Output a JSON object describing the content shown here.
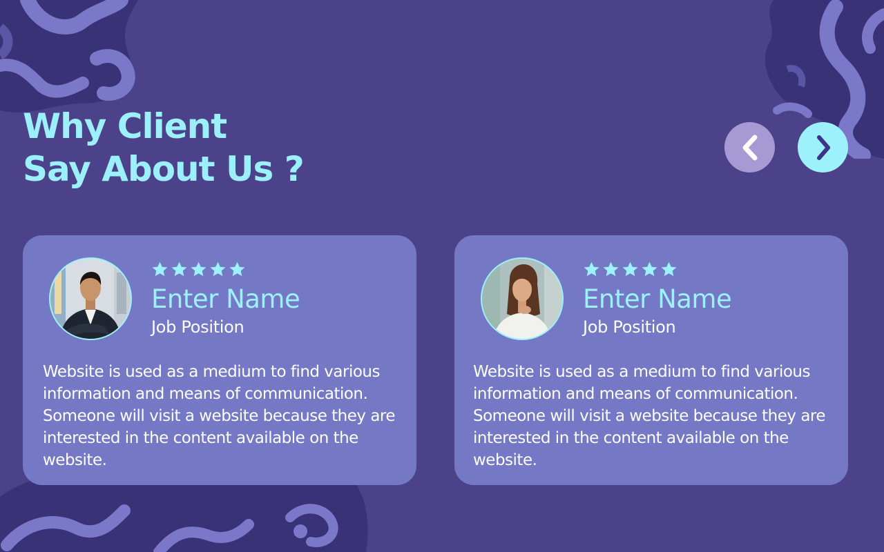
{
  "page": {
    "heading_line1": "Why Client",
    "heading_line2": "Say About Us ?"
  },
  "navigation": {
    "prev_icon": "chevron-left-icon",
    "next_icon": "chevron-right-icon"
  },
  "testimonials": [
    {
      "rating": 5,
      "rating_max": 5,
      "name": "Enter Name",
      "position": "Job Position",
      "text": "Website is used as a medium to find various information and means of communication. Someone will visit a website because they are interested in the content available on the website."
    },
    {
      "rating": 5,
      "rating_max": 5,
      "name": "Enter Name",
      "position": "Job Position",
      "text": "Website is used as a medium to find various information and means of communication. Someone will visit a website because they are interested in the content available on the website."
    }
  ],
  "colors": {
    "background": "#4b4289",
    "card": "#7578c4",
    "accent": "#9cf1fb",
    "prev_button": "#a79ad4",
    "text": "#ffffff"
  }
}
